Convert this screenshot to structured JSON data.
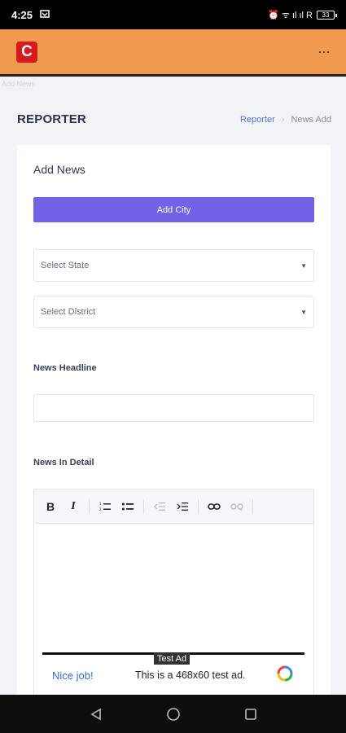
{
  "status_bar": {
    "time": "4:25",
    "indicators": "⏰ ᯤ ıl ıl R",
    "battery": "33"
  },
  "app_bar": {
    "logo_letter": "C",
    "menu": "···"
  },
  "faint_text": "Add News",
  "header": {
    "title": "REPORTER",
    "breadcrumb_link": "Reporter",
    "breadcrumb_sep": "›",
    "breadcrumb_current": "News Add"
  },
  "form": {
    "title": "Add News",
    "add_city_button": "Add City",
    "state_select": "Select State",
    "district_select": "Select District",
    "headline_label": "News Headline",
    "detail_label": "News In Detail",
    "headline_value": ""
  },
  "editor_toolbar": {
    "bold": "B",
    "italic": "I"
  },
  "ad": {
    "tag": "Test Ad",
    "nice": "Nice job!",
    "text": "This is a 468x60 test ad."
  },
  "colors": {
    "app_bar": "#f0994f",
    "accent_button": "#7162e8",
    "logo": "#d71920",
    "link": "#5b73c9"
  }
}
